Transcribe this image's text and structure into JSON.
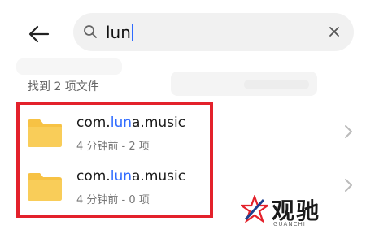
{
  "search": {
    "query": "lun",
    "clear_icon": "close-icon",
    "search_icon": "search-icon"
  },
  "results": {
    "count_label": "找到 2 项文件",
    "items": [
      {
        "name_prefix": "com.",
        "name_highlight": "lun",
        "name_suffix": "a.music",
        "meta": "4 分钟前 - 2 项",
        "icon": "folder-icon"
      },
      {
        "name_prefix": "com.",
        "name_highlight": "lun",
        "name_suffix": "a.music",
        "meta": "4 分钟前 - 0 项",
        "icon": "folder-icon"
      }
    ]
  },
  "watermark": {
    "title": "观驰",
    "subtitle": "GUANCHI"
  },
  "colors": {
    "highlight": "#2f6bff",
    "annotation_box": "#e3212b",
    "folder": "#f7c244"
  }
}
